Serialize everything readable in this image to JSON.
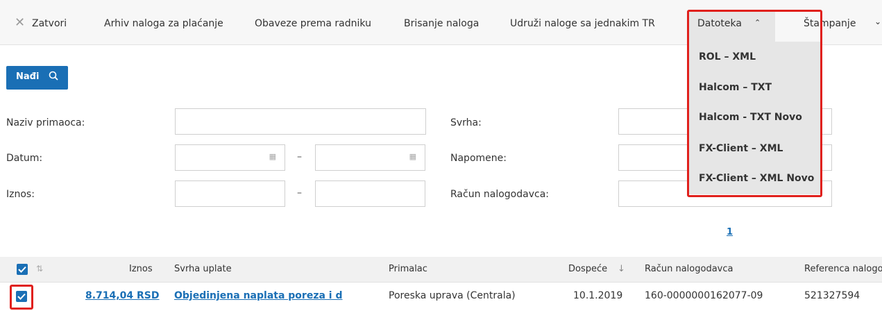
{
  "toolbar": {
    "close_label": "Zatvori",
    "archive_label": "Arhiv naloga za plaćanje",
    "obligations_label": "Obaveze prema radniku",
    "delete_label": "Brisanje naloga",
    "merge_label": "Udruži naloge sa jednakim TR",
    "file_label": "Datoteka",
    "print_label": "Štampanje"
  },
  "file_menu": {
    "items": [
      "ROL – XML",
      "Halcom – TXT",
      "Halcom - TXT Novo",
      "FX-Client – XML",
      "FX-Client – XML Novo"
    ]
  },
  "search": {
    "find_label": "Nađi"
  },
  "filters": {
    "recipient_name": "Naziv primaoca:",
    "date": "Datum:",
    "amount": "Iznos:",
    "purpose": "Svrha:",
    "notes": "Napomene:",
    "payer_account": "Račun nalogodavca:",
    "range_dash": "–"
  },
  "pagination": {
    "page": "1"
  },
  "table": {
    "headers": {
      "amount": "Iznos",
      "purpose": "Svrha uplate",
      "recipient": "Primalac",
      "due": "Dospeće",
      "payer_account": "Račun nalogodavca",
      "reference": "Referenca nalogo"
    },
    "rows": [
      {
        "amount": "8.714,04 RSD",
        "purpose": "Objedinjena naplata poreza i d",
        "recipient": "Poreska uprava (Centrala)",
        "due": "10.1.2019",
        "payer_account": "160-0000000162077-09",
        "reference": "521327594"
      }
    ]
  },
  "colors": {
    "accent": "#1a6fb5",
    "highlight": "#e0201c"
  }
}
